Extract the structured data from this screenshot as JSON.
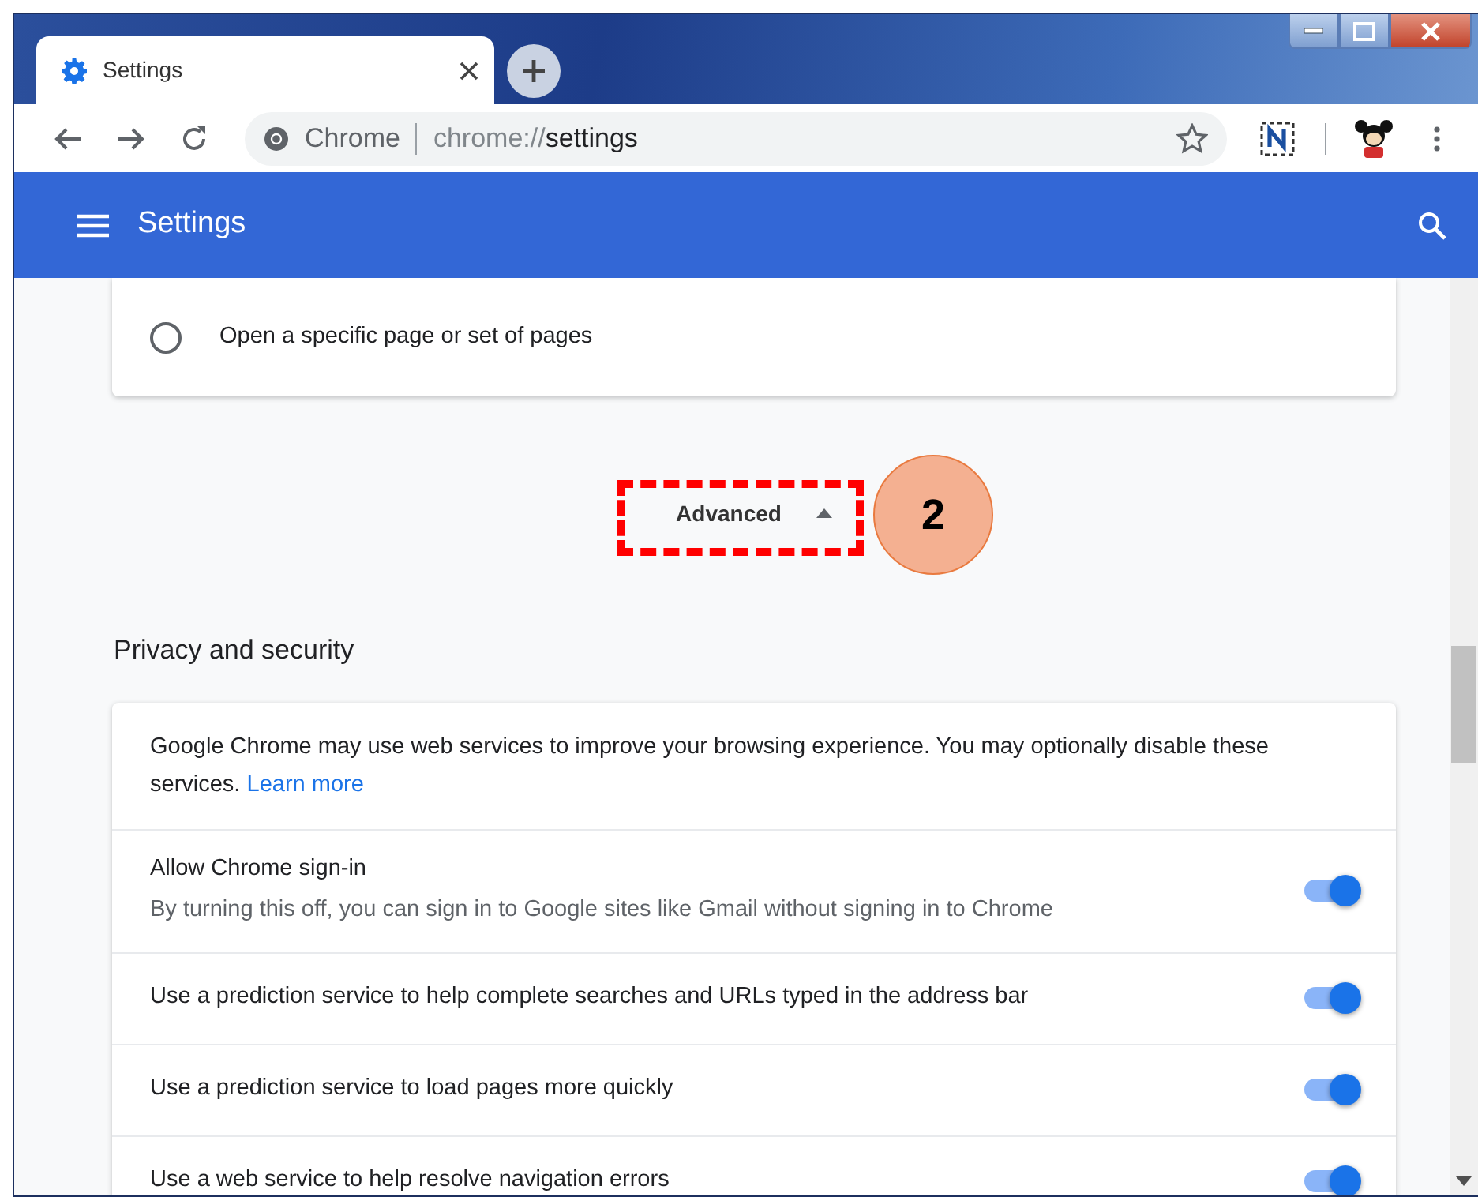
{
  "browser": {
    "tab_title": "Settings",
    "site_label": "Chrome",
    "url_scheme": "chrome://",
    "url_path": "settings"
  },
  "header": {
    "title": "Settings"
  },
  "startup_option": {
    "label": "Open a specific page or set of pages",
    "selected": false
  },
  "advanced": {
    "label": "Advanced",
    "expanded": true
  },
  "callout": {
    "number": "2"
  },
  "section_title": "Privacy and security",
  "intro": {
    "text": "Google Chrome may use web services to improve your browsing experience. You may optionally disable these services.",
    "link": "Learn more"
  },
  "settings": [
    {
      "label": "Allow Chrome sign-in",
      "description": "By turning this off, you can sign in to Google sites like Gmail without signing in to Chrome",
      "on": true
    },
    {
      "label": "Use a prediction service to help complete searches and URLs typed in the address bar",
      "on": true
    },
    {
      "label": "Use a prediction service to load pages more quickly",
      "on": true
    },
    {
      "label": "Use a web service to help resolve navigation errors",
      "on": true
    }
  ]
}
